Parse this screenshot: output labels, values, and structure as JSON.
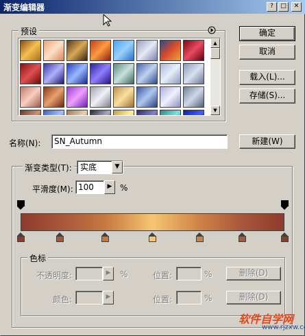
{
  "window": {
    "title": "渐变编辑器"
  },
  "title_buttons": {
    "help": "?",
    "maximize": "□",
    "close": "✕"
  },
  "presets": {
    "label": "预设",
    "menu_icon": "play-circle-icon",
    "swatches": [
      "linear-gradient(135deg,#8a4b12,#f3c152,#b06a1c)",
      "linear-gradient(135deg,#e9a47c,#fde0c8,#d98652)",
      "linear-gradient(135deg,#5a3a1a,#d8a857,#3a2410)",
      "linear-gradient(135deg,#c04020,#ff9a40,#8a2010)",
      "linear-gradient(135deg,#4aa0e8,#9ad0ff,#2a70c8)",
      "linear-gradient(135deg,#9aa0c0,#e6e8f4,#7a80a8)",
      "linear-gradient(135deg,#2a4a8a,#d84a2a,#f0a040)",
      "linear-gradient(135deg,#7a0818,#e84a60,#600010)",
      "linear-gradient(135deg,#8a1010,#e05050,#6a0808)",
      "linear-gradient(135deg,#3a3aa0,#b0b0ff,#1a1a70)",
      "linear-gradient(135deg,#2a40c0,#9ab8ff,#1a2a90)",
      "linear-gradient(135deg,#3020a0,#9080ff,#2a1080)",
      "linear-gradient(135deg,#5a8a80,#c8e0dc,#3a6a60)",
      "linear-gradient(135deg,#4a6aa8,#c0d0f0,#2a4a88)",
      "linear-gradient(135deg,#a8b8d8,#e8eef8,#8898c0)",
      "linear-gradient(135deg,#8a98b8,#d8e0f0,#6a7898)",
      "linear-gradient(135deg,#c07868,#f8d0c0,#a05848)",
      "linear-gradient(135deg,#8a3a1a,#e8a070,#6a2a10)",
      "linear-gradient(135deg,#9a40d0,#f0a0ff,#7020b0)",
      "linear-gradient(135deg,#a0a0a8,#f0f0f8,#808088)",
      "linear-gradient(135deg,#c09050,#f8e0a0,#a07030)",
      "linear-gradient(135deg,#3a58a0,#b0c8f0,#2a4080)",
      "linear-gradient(135deg,#a8b0d8,#f0f0ff,#8890c0)",
      "linear-gradient(135deg,#708098,#d0d8e8,#506078)",
      "linear-gradient(135deg,#6a3a2a,#d09070,#4a2010)",
      "linear-gradient(135deg,#4060c0,#a0c0ff,#2040a0)",
      "linear-gradient(135deg,#a07850,#e8d0b0,#806040)",
      "linear-gradient(135deg,#2a2a3a,#a8a8c0,#1a1a28)",
      "linear-gradient(135deg,#c0a040,#fff0a0,#907020)",
      "linear-gradient(135deg,#2a2a6a,#8080d0,#101040)",
      "linear-gradient(135deg,#2a8a8a,#80e0e0,#106060)",
      "linear-gradient(135deg,#1020a0,#4060ff,#000060)"
    ]
  },
  "buttons": {
    "ok": "确定",
    "cancel": "取消",
    "load": "载入(L)...",
    "save": "存储(S)...",
    "new": "新建(W)"
  },
  "name_field": {
    "label": "名称(N):",
    "value": "SN_Autumn"
  },
  "gradient_type": {
    "label": "渐变类型(T):",
    "value": "实底",
    "smoothness_label": "平滑度(M):",
    "smoothness_value": "100",
    "smoothness_unit": "%"
  },
  "gradient_stops": {
    "opacity_stop_positions": [
      0,
      100
    ],
    "color_stops": [
      {
        "location": 0,
        "color": "#8e3b2d"
      },
      {
        "location": 15,
        "color": "#a6563a"
      },
      {
        "location": 32,
        "color": "#c7783f"
      },
      {
        "location": 50,
        "color": "#f5c572"
      },
      {
        "location": 68,
        "color": "#cf8246"
      },
      {
        "location": 84,
        "color": "#a9573c"
      },
      {
        "location": 100,
        "color": "#8e3b2d"
      }
    ]
  },
  "stops_panel": {
    "label": "色标",
    "opacity_label": "不透明度:",
    "opacity_unit": "%",
    "location_label": "位置:",
    "location_unit": "%",
    "delete_label": "删除(D)",
    "color_label": "颜色:"
  },
  "watermark": {
    "text": "软件自学网",
    "url": "www.rjzxw.com"
  }
}
